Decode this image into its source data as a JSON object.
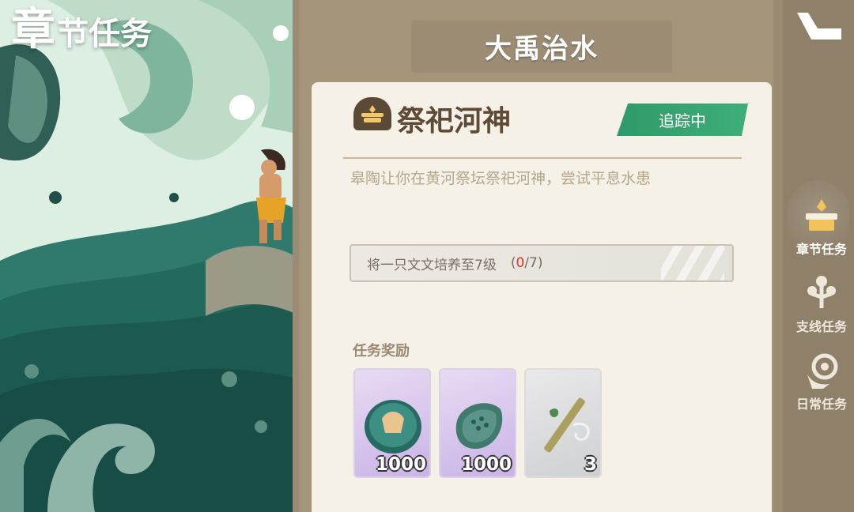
{
  "page_title": {
    "big": "章",
    "rest": "节任务"
  },
  "chapter": {
    "title": "大禹治水"
  },
  "quest": {
    "name": "祭祀河神",
    "status": "追踪中",
    "description": "皋陶让你在黄河祭坛祭祀河神，尝试平息水患",
    "objective": {
      "text": "将一只文文培养至7级",
      "current": "0",
      "total": "/7)",
      "open": "("
    }
  },
  "rewards": {
    "title": "任务奖励",
    "items": [
      {
        "icon": "jade-coin-icon",
        "count": "1000"
      },
      {
        "icon": "jade-tablet-icon",
        "count": "1000"
      },
      {
        "icon": "bamboo-flute-icon",
        "count": "3"
      }
    ]
  },
  "nav": {
    "items": [
      {
        "label": "章节任务",
        "icon": "altar-icon"
      },
      {
        "label": "支线任务",
        "icon": "branch-icon"
      },
      {
        "label": "日常任务",
        "icon": "bird-icon"
      }
    ]
  },
  "colors": {
    "accent_green": "#3fae79",
    "panel": "#f6f1e6",
    "frame": "#9a8b72",
    "progress_red": "#d0342c"
  }
}
